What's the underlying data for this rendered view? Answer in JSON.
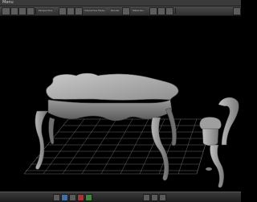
{
  "menubar": {
    "title": "Menu"
  },
  "toolbar": {
    "labels": [
      "Perspective",
      "Interactive Mode",
      "Render",
      "Materials"
    ]
  },
  "icons": {
    "toolbar": [
      "select-icon",
      "move-icon",
      "rotate-icon",
      "scale-icon",
      "sculpt-icon",
      "paint-icon",
      "smooth-icon",
      "mask-icon",
      "render-icon",
      "camera-icon",
      "light-icon",
      "grid-icon",
      "settings-icon"
    ],
    "bottom": [
      "object-icon",
      "subdivide-icon",
      "camera-icon",
      "light-icon",
      "material-icon",
      "texture-icon",
      "display-icon",
      "grid-icon"
    ]
  },
  "colors": {
    "toolbar_bg": "#3a3a3a",
    "viewport_bg": "#000000",
    "grid_line": "#6a6a6a",
    "model_base": "#8f8f8f",
    "model_highlight": "#c9c9c9",
    "model_shadow": "#4f4f4f"
  }
}
